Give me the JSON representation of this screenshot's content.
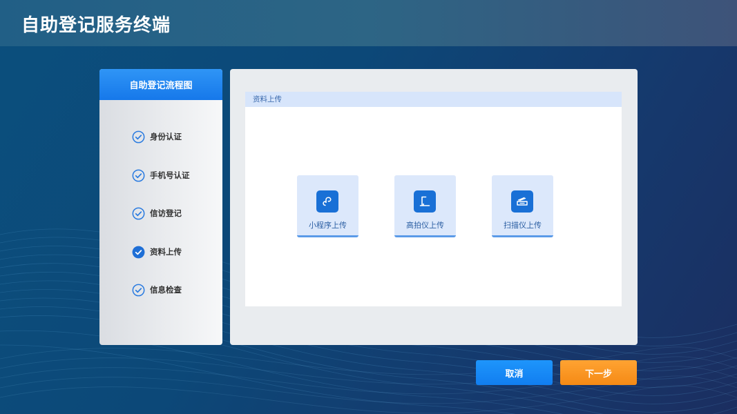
{
  "header": {
    "title": "自助登记服务终端"
  },
  "sidebar": {
    "title": "自助登记流程图",
    "steps": [
      {
        "label": "身份认证",
        "state": "done"
      },
      {
        "label": "手机号认证",
        "state": "done"
      },
      {
        "label": "信访登记",
        "state": "done"
      },
      {
        "label": "资料上传",
        "state": "current"
      },
      {
        "label": "信息检查",
        "state": "done"
      }
    ]
  },
  "main": {
    "section_title": "资料上传",
    "options": [
      {
        "label": "小程序上传",
        "icon": "mini-program-icon"
      },
      {
        "label": "高拍仪上传",
        "icon": "document-camera-icon"
      },
      {
        "label": "扫描仪上传",
        "icon": "scanner-icon"
      }
    ]
  },
  "buttons": {
    "cancel": "取消",
    "next": "下一步"
  },
  "colors": {
    "accent_blue": "#1678ea",
    "accent_orange": "#f58a15",
    "section_header_bg": "#d7e5fb"
  }
}
